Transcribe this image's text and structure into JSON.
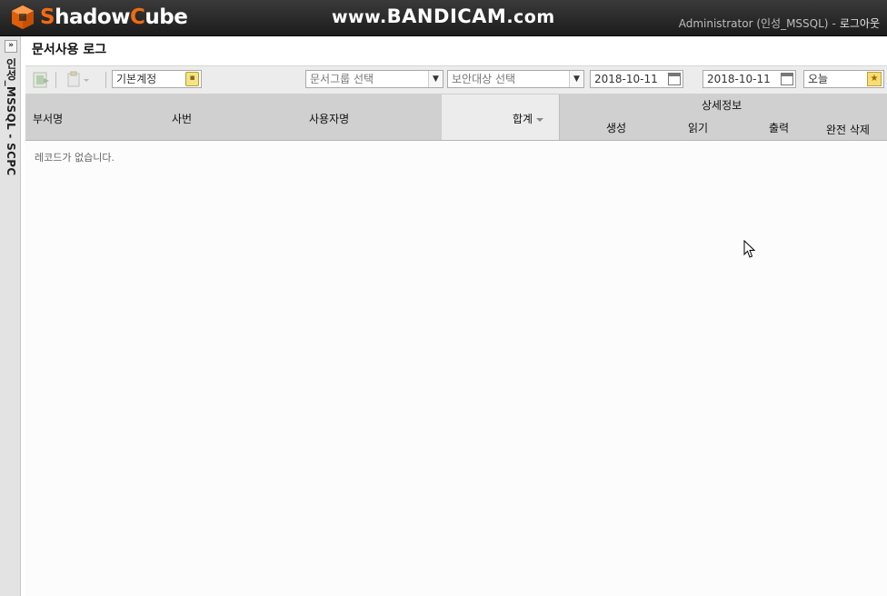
{
  "header": {
    "logo_text_s": "S",
    "logo_text_rest1": "hadow",
    "logo_text_c": "C",
    "logo_text_rest2": "ube",
    "watermark_prefix": "www.",
    "watermark_brand": "BANDICAM",
    "watermark_suffix": ".com",
    "user_label": "Administrator (인성_MSSQL)",
    "separator": "-",
    "logout_label": "로그아웃"
  },
  "leftpanel": {
    "expand_glyph": "»",
    "vertical_title": "인성_MSSQL - SCPC"
  },
  "page": {
    "title": "문서사용 로그"
  },
  "toolbar": {
    "account_value": "기본계정",
    "doc_group_placeholder": "문서그룹 선택",
    "security_target_placeholder": "보안대상 선택",
    "date_from": "2018-10-11",
    "date_range_sep": "~",
    "date_to": "2018-10-11",
    "period_value": "오늘"
  },
  "table": {
    "columns": {
      "dept": "부서명",
      "emp_no": "사번",
      "user_name": "사용자명",
      "total": "합계",
      "detail_group": "상세정보",
      "create": "생성",
      "read": "읽기",
      "print": "출력",
      "full_delete": "완전 삭제"
    },
    "sorted_column": "total",
    "rows": [],
    "empty_message": "레코드가 없습니다."
  },
  "colors": {
    "brand_orange": "#f26b12",
    "header_bg": "#2a2a2a",
    "table_header_bg": "#d0d0d0",
    "toolbar_bg": "#ececec"
  },
  "icons": [
    "logo-cube-icon",
    "export-excel-icon",
    "copy-dropdown-icon",
    "trash-icon",
    "dropdown-caret-icon",
    "calendar-icon",
    "star-icon",
    "sort-desc-icon",
    "mouse-cursor-icon"
  ]
}
